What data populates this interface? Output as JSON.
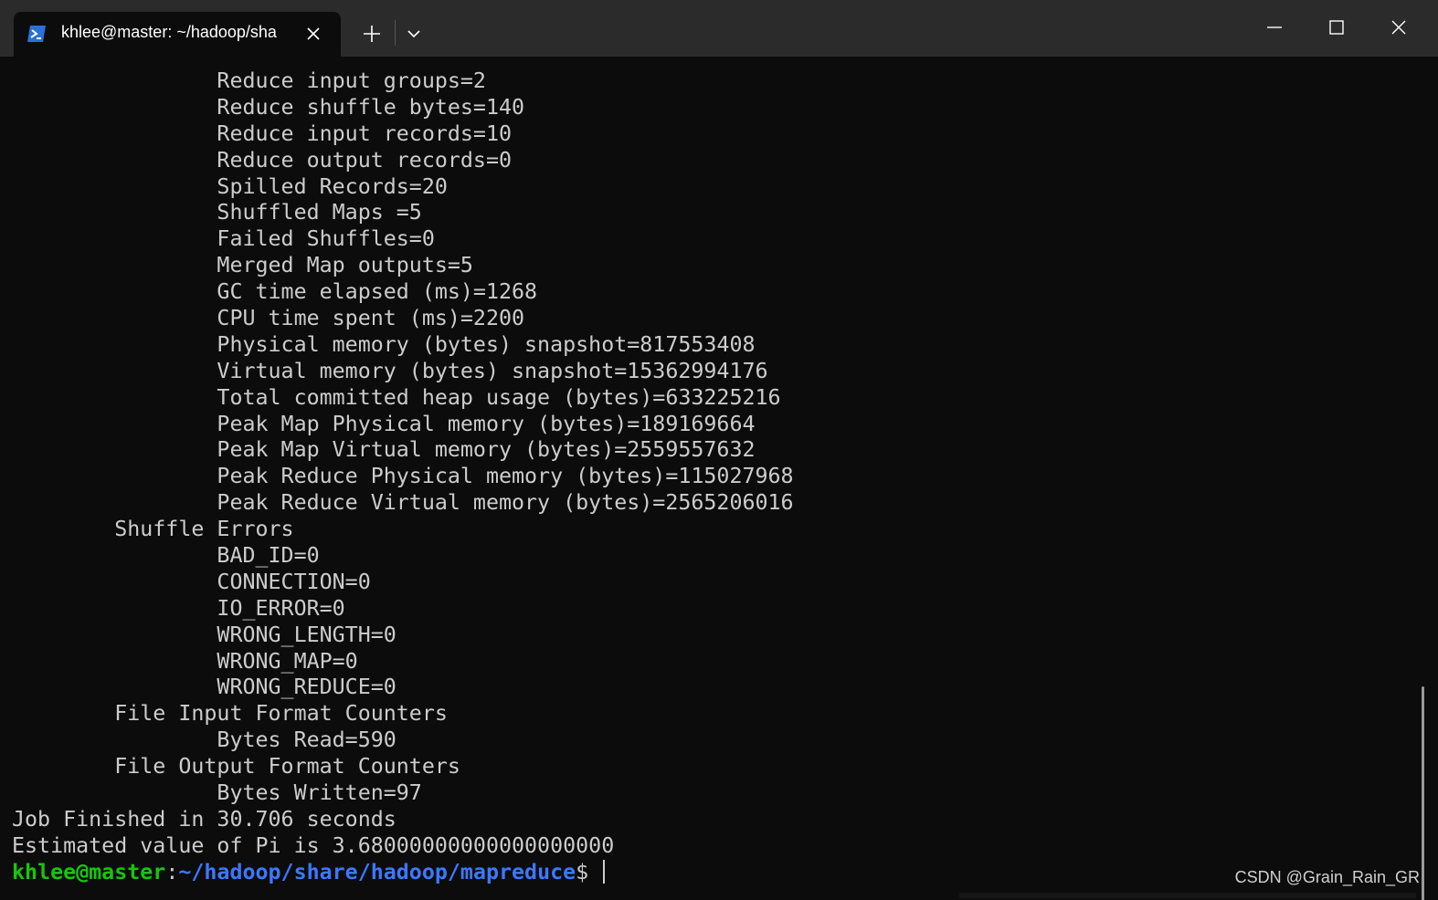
{
  "window": {
    "tab_title": "khlee@master: ~/hadoop/sha",
    "tab_icon": "powershell-icon",
    "colors": {
      "background": "#0c0c0c",
      "titlebar": "#2b2b2b",
      "text": "#cccccc",
      "prompt_user": "#16c60c",
      "prompt_path": "#3b78ff"
    }
  },
  "terminal": {
    "lines": [
      "                Reduce input groups=2",
      "                Reduce shuffle bytes=140",
      "                Reduce input records=10",
      "                Reduce output records=0",
      "                Spilled Records=20",
      "                Shuffled Maps =5",
      "                Failed Shuffles=0",
      "                Merged Map outputs=5",
      "                GC time elapsed (ms)=1268",
      "                CPU time spent (ms)=2200",
      "                Physical memory (bytes) snapshot=817553408",
      "                Virtual memory (bytes) snapshot=15362994176",
      "                Total committed heap usage (bytes)=633225216",
      "                Peak Map Physical memory (bytes)=189169664",
      "                Peak Map Virtual memory (bytes)=2559557632",
      "                Peak Reduce Physical memory (bytes)=115027968",
      "                Peak Reduce Virtual memory (bytes)=2565206016",
      "        Shuffle Errors",
      "                BAD_ID=0",
      "                CONNECTION=0",
      "                IO_ERROR=0",
      "                WRONG_LENGTH=0",
      "                WRONG_MAP=0",
      "                WRONG_REDUCE=0",
      "        File Input Format Counters",
      "                Bytes Read=590",
      "        File Output Format Counters",
      "                Bytes Written=97",
      "Job Finished in 30.706 seconds",
      "Estimated value of Pi is 3.68000000000000000000"
    ],
    "prompt": {
      "user_host": "khlee@master",
      "separator": ":",
      "path": "~/hadoop/share/hadoop/mapreduce",
      "symbol": "$ "
    }
  },
  "watermark": "CSDN @Grain_Rain_GR"
}
